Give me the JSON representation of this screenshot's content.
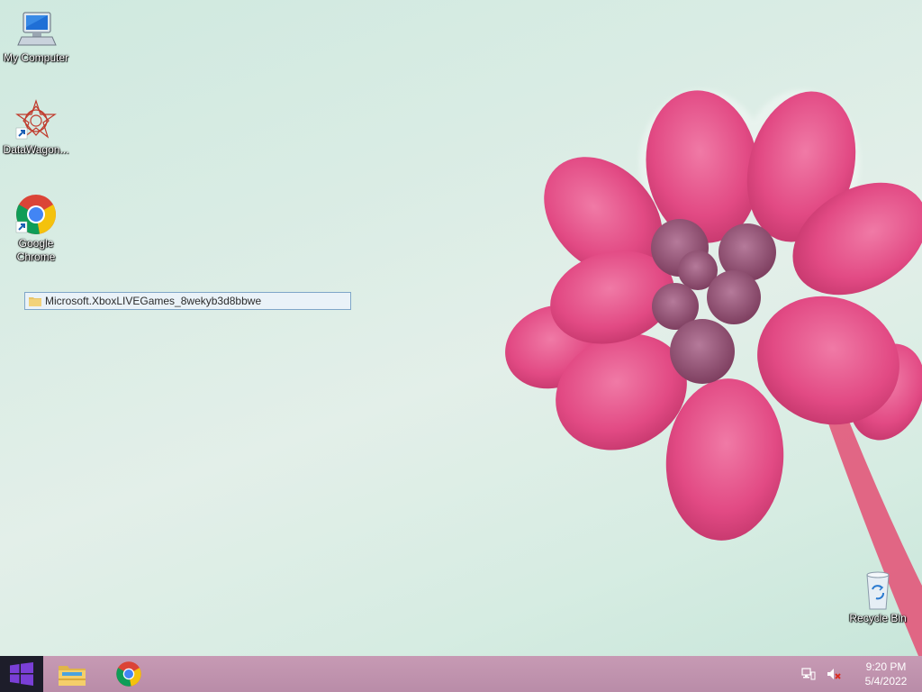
{
  "desktop": {
    "icons": [
      {
        "label": "My Computer",
        "icon": "computer-icon"
      },
      {
        "label": "DataWagon...",
        "icon": "datawagon-icon"
      },
      {
        "label": "Google Chrome",
        "icon": "chrome-icon"
      },
      {
        "label": "Recycle Bin",
        "icon": "recycle-bin-icon"
      }
    ],
    "rename": {
      "value": "Microsoft.XboxLIVEGames_8wekyb3d8bbwe",
      "icon": "folder-icon"
    },
    "wallpaper": {
      "background": "#d6ece2",
      "flower_color": "#e0507f"
    }
  },
  "taskbar": {
    "color": "#bf93ae",
    "start": {
      "icon": "windows-logo-icon"
    },
    "pinned": [
      {
        "icon": "file-explorer-icon"
      },
      {
        "icon": "chrome-icon"
      }
    ],
    "tray": {
      "icons": [
        "network-icon",
        "volume-muted-icon"
      ],
      "time": "9:20 PM",
      "date": "5/4/2022"
    }
  }
}
